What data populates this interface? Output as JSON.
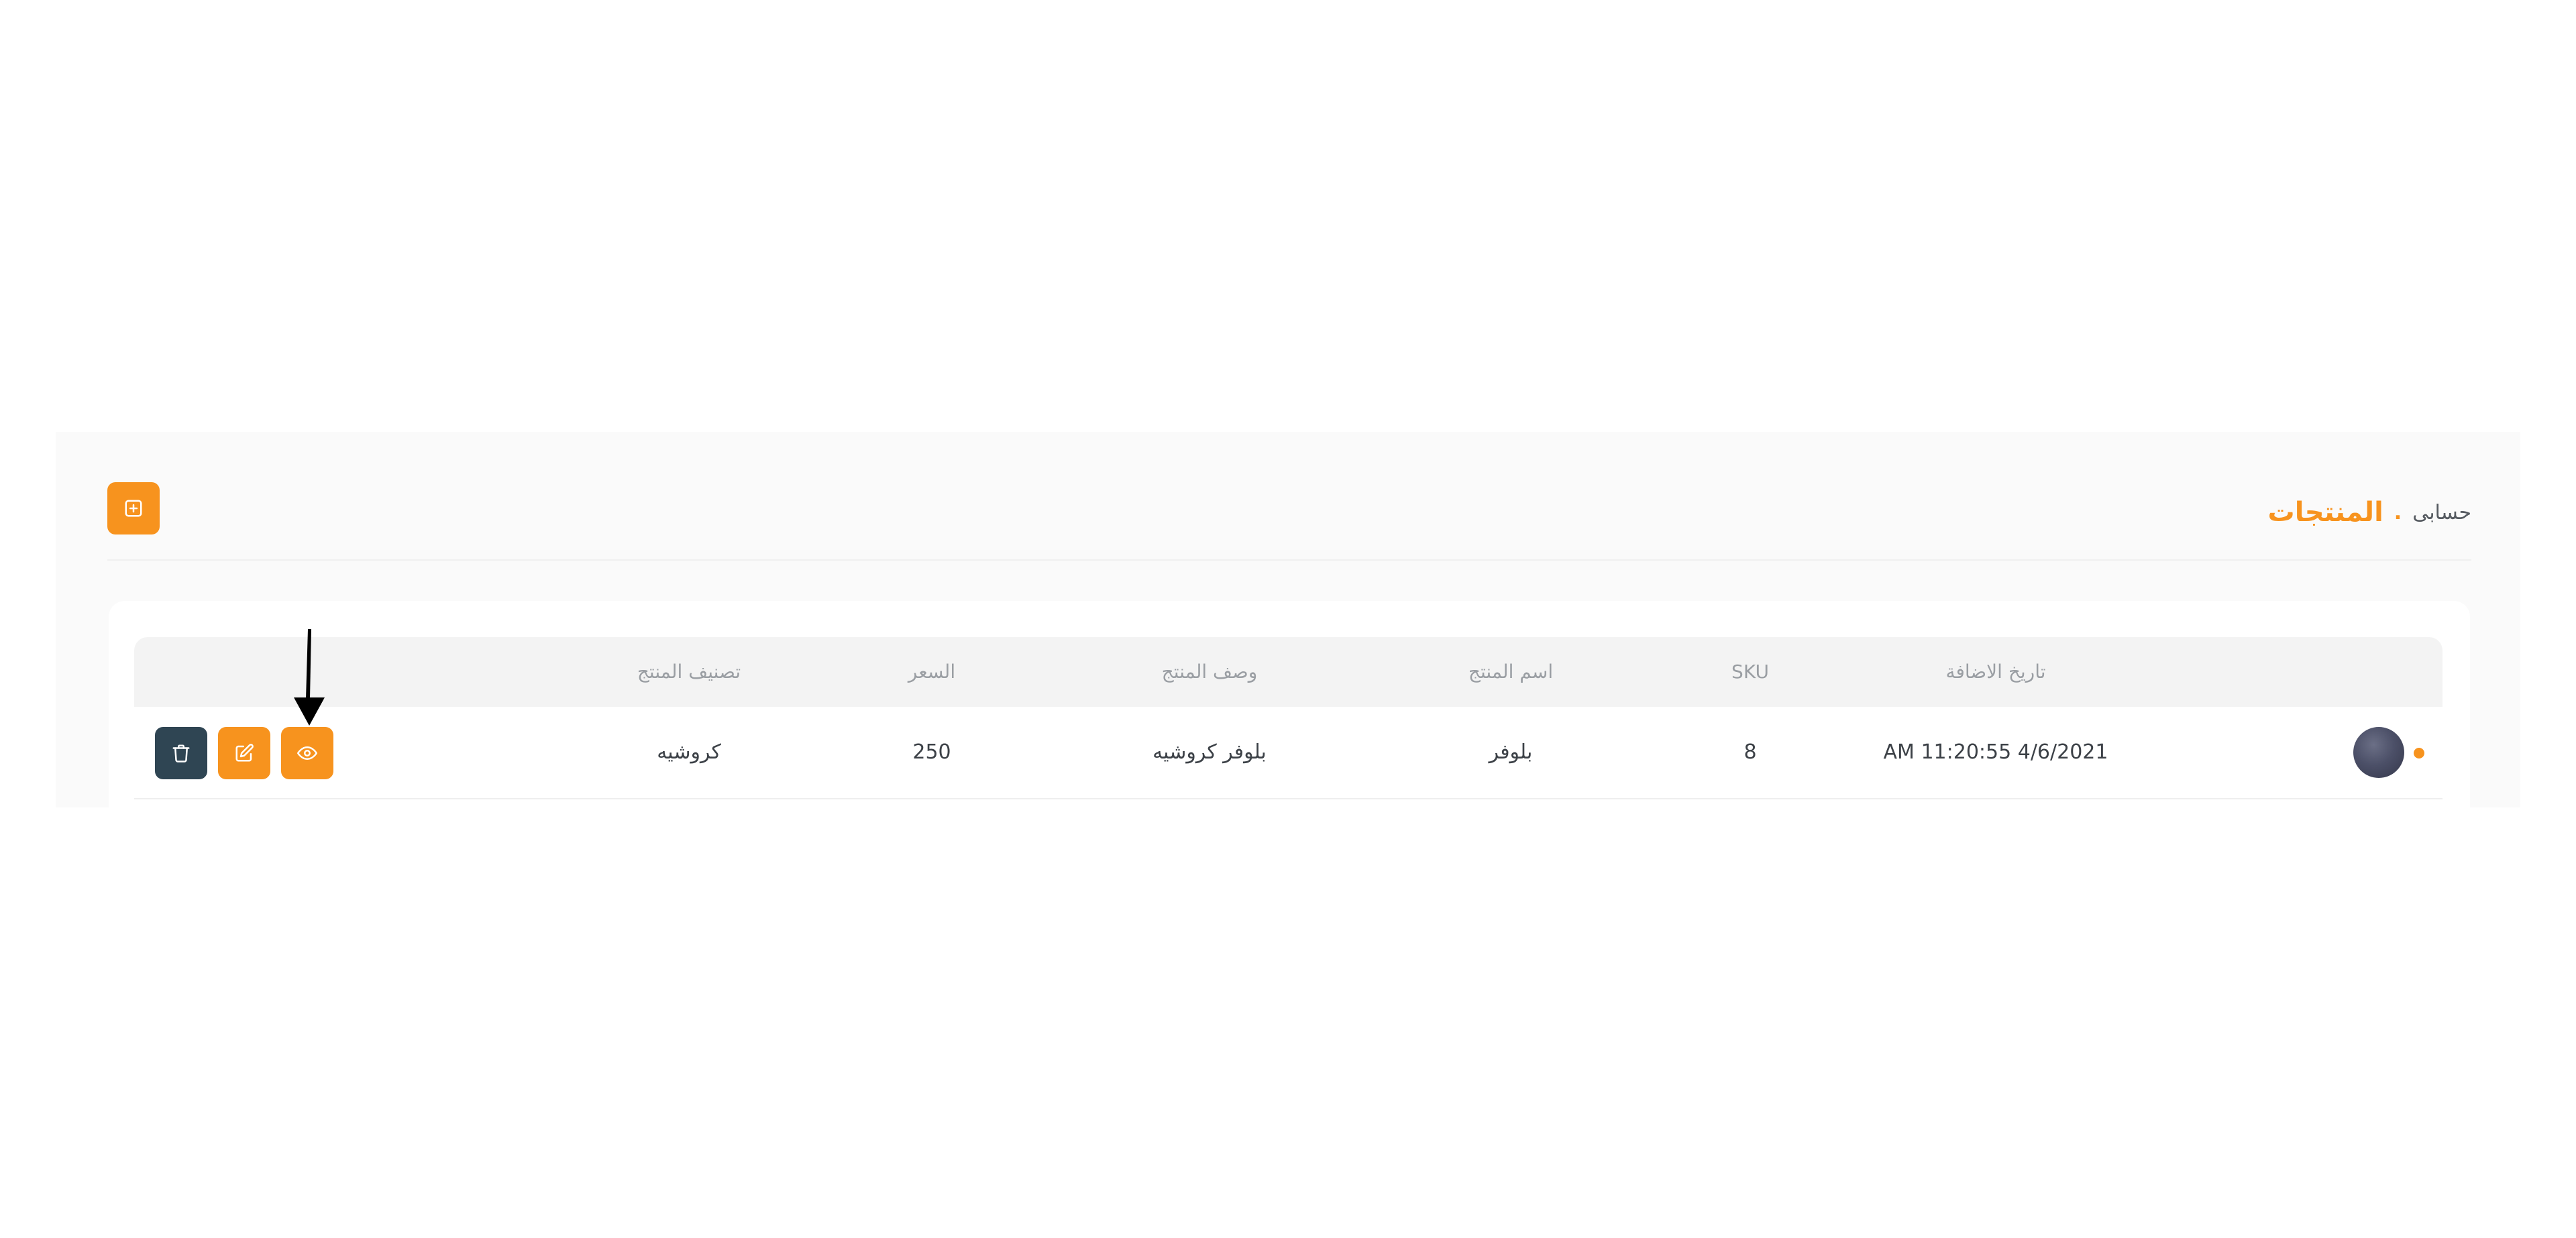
{
  "breadcrumb": {
    "parent": "حسابى",
    "separator": ".",
    "current": "المنتجات"
  },
  "toolbar": {
    "add_icon": "plus-square-icon"
  },
  "table": {
    "columns": [
      "تاريخ الاضافة",
      "SKU",
      "اسم المنتج",
      "وصف المنتج",
      "السعر",
      "تصنيف المنتج"
    ],
    "rows": [
      {
        "date_added": "AM 11:20:55 4/6/2021",
        "sku": "8",
        "name": "بلوفر",
        "description": "بلوفر كروشيه",
        "price": "250",
        "category": "كروشيه",
        "actions": [
          "eye-icon",
          "edit-icon",
          "trash-icon"
        ]
      }
    ]
  },
  "colors": {
    "accent": "#f7931e",
    "delete_button": "#2f4553",
    "panel_background": "#fafafa"
  },
  "annotation": {
    "arrow_icon": "down-arrow-annotation"
  }
}
